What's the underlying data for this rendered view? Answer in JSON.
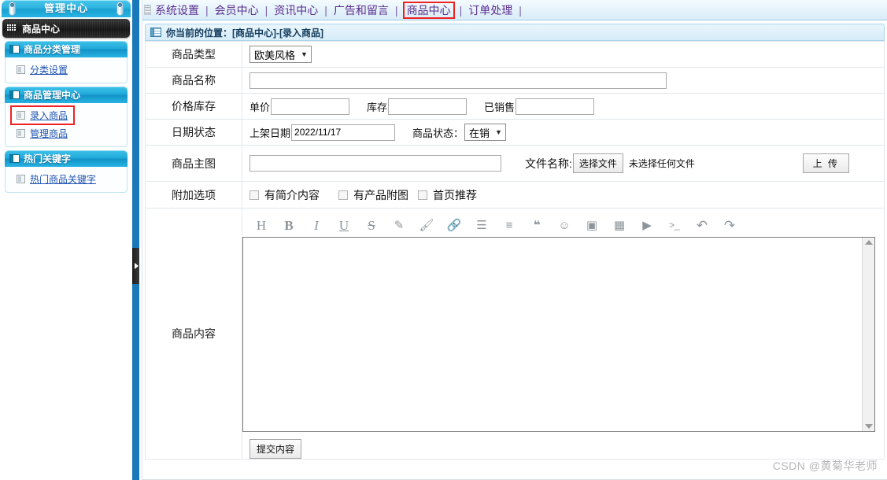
{
  "sidebar": {
    "header_title": "管理中心",
    "current": {
      "label": "商品中心",
      "icon": "grid-icon"
    },
    "groups": [
      {
        "title": "商品分类管理",
        "items": [
          {
            "label": "分类设置",
            "highlighted": false
          }
        ]
      },
      {
        "title": "商品管理中心",
        "items": [
          {
            "label": "录入商品",
            "highlighted": true
          },
          {
            "label": "管理商品",
            "highlighted": false
          }
        ]
      },
      {
        "title": "热门关键字",
        "items": [
          {
            "label": "热门商品关键字",
            "highlighted": false
          }
        ]
      }
    ]
  },
  "topnav": {
    "separator": "|",
    "items": [
      {
        "label": "系统设置",
        "active": false
      },
      {
        "label": "会员中心",
        "active": false
      },
      {
        "label": "资讯中心",
        "active": false
      },
      {
        "label": "广告和留言",
        "active": false
      },
      {
        "label": "商品中心",
        "active": true
      },
      {
        "label": "订单处理",
        "active": false
      }
    ]
  },
  "breadcrumb": {
    "text": "你当前的位置：[商品中心]-[录入商品]"
  },
  "form": {
    "labels": {
      "product_type": "商品类型",
      "product_name": "商品名称",
      "price_stock": "价格库存",
      "date_status": "日期状态",
      "main_image": "商品主图",
      "extra_options": "附加选项",
      "content": "商品内容"
    },
    "product_type": {
      "value": "欧美风格",
      "options": [
        "欧美风格"
      ]
    },
    "product_name": {
      "value": "",
      "placeholder": ""
    },
    "price": {
      "label": "单价",
      "value": "",
      "placeholder": ""
    },
    "stock": {
      "label": "库存",
      "value": "",
      "placeholder": ""
    },
    "sold": {
      "label": "已销售",
      "value": "",
      "placeholder": ""
    },
    "shelf_date": {
      "label": "上架日期",
      "value": "2022/11/17"
    },
    "product_status": {
      "label": "商品状态：",
      "value": "在销",
      "options": [
        "在销"
      ]
    },
    "main_image": {
      "value": "",
      "placeholder": ""
    },
    "file": {
      "label": "文件名称:",
      "choose_button": "选择文件",
      "no_file_text": "未选择任何文件",
      "upload_button": "上 传"
    },
    "checkboxes": [
      {
        "label": "有简介内容",
        "checked": false
      },
      {
        "label": "有产品附图",
        "checked": false
      },
      {
        "label": "首页推荐",
        "checked": false
      }
    ],
    "editor": {
      "toolbar": [
        {
          "name": "heading-icon",
          "glyph": "H"
        },
        {
          "name": "bold-icon",
          "glyph": "B"
        },
        {
          "name": "italic-icon",
          "glyph": "I"
        },
        {
          "name": "underline-icon",
          "glyph": "U"
        },
        {
          "name": "strikethrough-icon",
          "glyph": "S"
        },
        {
          "name": "pen-icon",
          "glyph": "✎"
        },
        {
          "name": "brush-icon",
          "glyph": "🖌"
        },
        {
          "name": "link-icon",
          "glyph": "🔗"
        },
        {
          "name": "bullet-list-icon",
          "glyph": "☰"
        },
        {
          "name": "align-icon",
          "glyph": "≡"
        },
        {
          "name": "quote-icon",
          "glyph": "❝"
        },
        {
          "name": "emoji-icon",
          "glyph": "☺"
        },
        {
          "name": "image-icon",
          "glyph": "▣"
        },
        {
          "name": "table-icon",
          "glyph": "▦"
        },
        {
          "name": "video-icon",
          "glyph": "▶"
        },
        {
          "name": "code-icon",
          "glyph": ">_"
        },
        {
          "name": "undo-icon",
          "glyph": "↶"
        },
        {
          "name": "redo-icon",
          "glyph": "↷"
        }
      ],
      "content": ""
    },
    "submit_button": "提交内容"
  },
  "watermark": {
    "text": "CSDN @黄菊华老师"
  },
  "colors": {
    "accent_blue": "#1aa0d2",
    "splitter_blue": "#1878b9",
    "nav_purple": "#5b2d8e",
    "highlight_red": "#ef2121",
    "link_blue": "#1d52b3"
  }
}
